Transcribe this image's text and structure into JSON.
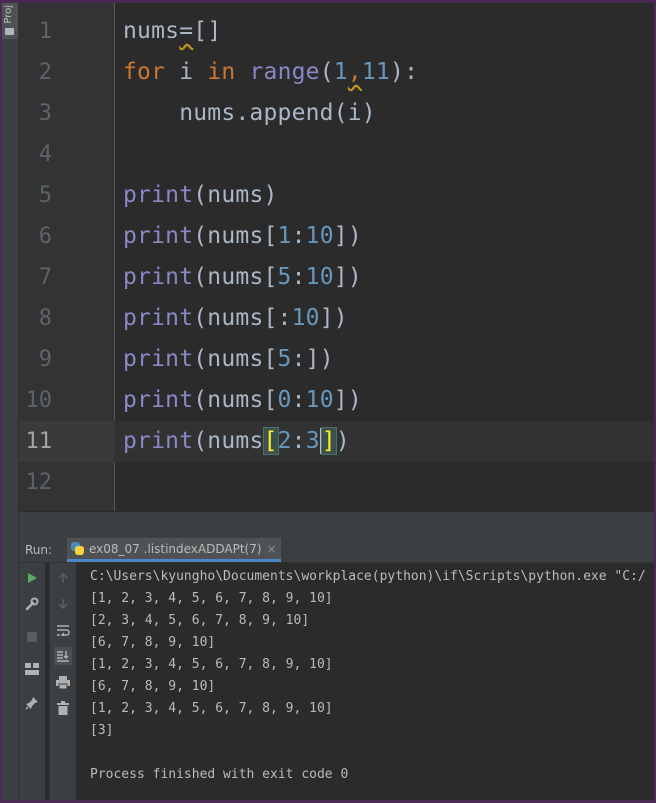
{
  "project_strip": {
    "label": "Proj"
  },
  "editor": {
    "lines": [
      {
        "number": "1",
        "segments": [
          {
            "t": "nums",
            "c": "plain"
          },
          {
            "t": "=",
            "c": "warn"
          },
          {
            "t": "[]",
            "c": "plain"
          }
        ]
      },
      {
        "number": "2",
        "segments": [
          {
            "t": "for",
            "c": "kw"
          },
          {
            "t": " i ",
            "c": "plain"
          },
          {
            "t": "in",
            "c": "kw"
          },
          {
            "t": " ",
            "c": "plain"
          },
          {
            "t": "range",
            "c": "bi"
          },
          {
            "t": "(",
            "c": "plain"
          },
          {
            "t": "1",
            "c": "num"
          },
          {
            "t": ",",
            "c": "kwwarn"
          },
          {
            "t": "11",
            "c": "num"
          },
          {
            "t": "):",
            "c": "plain"
          }
        ]
      },
      {
        "number": "3",
        "segments": [
          {
            "t": "    nums.append(i)",
            "c": "plain"
          }
        ]
      },
      {
        "number": "4",
        "segments": []
      },
      {
        "number": "5",
        "segments": [
          {
            "t": "print",
            "c": "bi"
          },
          {
            "t": "(nums)",
            "c": "plain"
          }
        ]
      },
      {
        "number": "6",
        "segments": [
          {
            "t": "print",
            "c": "bi"
          },
          {
            "t": "(nums[",
            "c": "plain"
          },
          {
            "t": "1",
            "c": "num"
          },
          {
            "t": ":",
            "c": "plain"
          },
          {
            "t": "10",
            "c": "num"
          },
          {
            "t": "])",
            "c": "plain"
          }
        ]
      },
      {
        "number": "7",
        "segments": [
          {
            "t": "print",
            "c": "bi"
          },
          {
            "t": "(nums[",
            "c": "plain"
          },
          {
            "t": "5",
            "c": "num"
          },
          {
            "t": ":",
            "c": "plain"
          },
          {
            "t": "10",
            "c": "num"
          },
          {
            "t": "])",
            "c": "plain"
          }
        ]
      },
      {
        "number": "8",
        "segments": [
          {
            "t": "print",
            "c": "bi"
          },
          {
            "t": "(nums[:",
            "c": "plain"
          },
          {
            "t": "10",
            "c": "num"
          },
          {
            "t": "])",
            "c": "plain"
          }
        ]
      },
      {
        "number": "9",
        "segments": [
          {
            "t": "print",
            "c": "bi"
          },
          {
            "t": "(nums[",
            "c": "plain"
          },
          {
            "t": "5",
            "c": "num"
          },
          {
            "t": ":])",
            "c": "plain"
          }
        ]
      },
      {
        "number": "10",
        "segments": [
          {
            "t": "print",
            "c": "bi"
          },
          {
            "t": "(nums[",
            "c": "plain"
          },
          {
            "t": "0",
            "c": "num"
          },
          {
            "t": ":",
            "c": "plain"
          },
          {
            "t": "10",
            "c": "num"
          },
          {
            "t": "])",
            "c": "plain"
          }
        ]
      },
      {
        "number": "11",
        "current": true,
        "segments": [
          {
            "t": "print",
            "c": "bi"
          },
          {
            "t": "(nums",
            "c": "plain"
          },
          {
            "t": "[",
            "c": "match"
          },
          {
            "t": "2",
            "c": "num"
          },
          {
            "t": ":",
            "c": "plain"
          },
          {
            "t": "3",
            "c": "numcaret"
          },
          {
            "t": "]",
            "c": "match"
          },
          {
            "t": ")",
            "c": "plain"
          }
        ]
      },
      {
        "number": "12",
        "segments": []
      }
    ]
  },
  "run_panel": {
    "label": "Run:",
    "tab_title": "ex08_07 .listindexADDAPt(7)",
    "tab_close": "×",
    "output": [
      "C:\\Users\\kyungho\\Documents\\workplace(python)\\if\\Scripts\\python.exe \"C:/",
      "[1, 2, 3, 4, 5, 6, 7, 8, 9, 10]",
      "[2, 3, 4, 5, 6, 7, 8, 9, 10]",
      "[6, 7, 8, 9, 10]",
      "[1, 2, 3, 4, 5, 6, 7, 8, 9, 10]",
      "[6, 7, 8, 9, 10]",
      "[1, 2, 3, 4, 5, 6, 7, 8, 9, 10]",
      "[3]",
      "",
      "Process finished with exit code 0"
    ]
  },
  "icons": {
    "run": "play-icon",
    "up": "arrow-up-icon",
    "down": "arrow-down-icon",
    "wrench": "wrench-icon",
    "wrap": "soft-wrap-icon",
    "stop": "stop-icon",
    "scroll": "scroll-to-end-icon",
    "layout": "layout-icon",
    "print": "print-icon",
    "pin": "pin-icon",
    "trash": "trash-icon"
  },
  "colors": {
    "accent_tab": "#4a88c7",
    "run_green": "#59a869",
    "window_border": "#4a2a55"
  }
}
